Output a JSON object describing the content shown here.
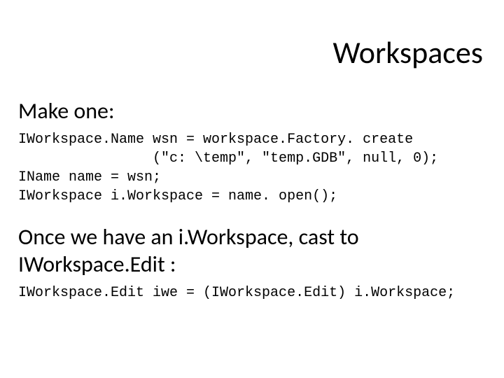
{
  "title": "Workspaces",
  "section1_heading": "Make one:",
  "code1_line1": "IWorkspace.Name wsn = workspace.Factory. create",
  "code1_line2": "                (\"c: \\temp\", \"temp.GDB\", null, 0);",
  "code1_line3": "IName name = wsn;",
  "code1_line4": "IWorkspace i.Workspace = name. open();",
  "section2_heading": "Once we have an i.Workspace, cast to IWorkspace.Edit :",
  "code2_line1": "IWorkspace.Edit iwe = (IWorkspace.Edit) i.Workspace;"
}
